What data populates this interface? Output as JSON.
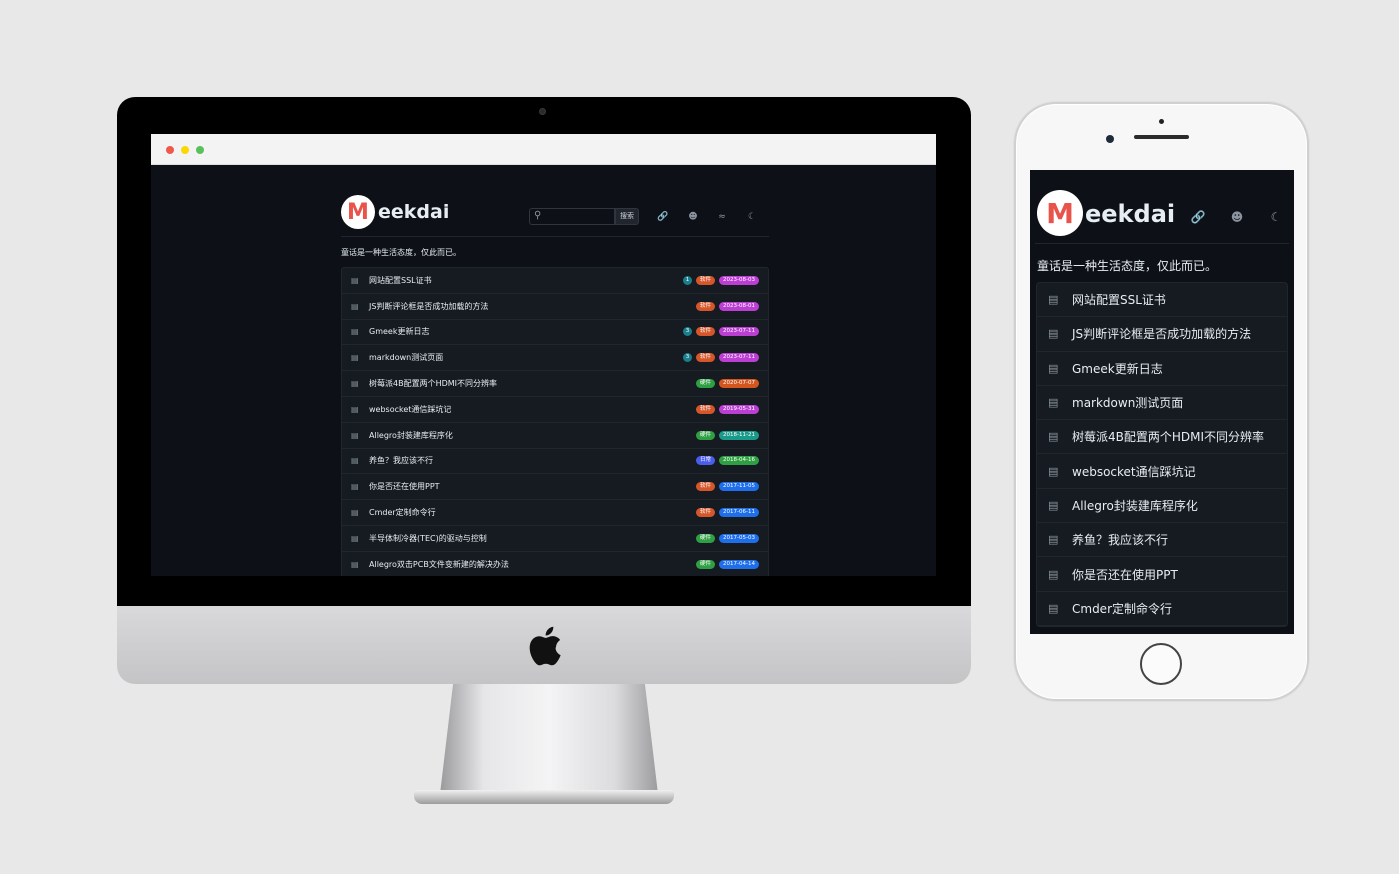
{
  "site": {
    "logo_letter": "M",
    "logo_text": "eekdai",
    "tagline": "童话是一种生活态度，仅此而已。",
    "search_placeholder": "",
    "search_button": "搜索",
    "header_icons": [
      "link-icon",
      "person-icon",
      "rss-icon",
      "moon-icon"
    ]
  },
  "colors": {
    "background": "#0d1117",
    "card": "#161b22",
    "text": "#e6edf3",
    "accent_logo": "#e8534a"
  },
  "posts": [
    {
      "title": "网站配置SSL证书",
      "count": "1",
      "label": "软件",
      "label_color": "#d4562a",
      "date": "2023-08-03",
      "date_color": "#bc3fd4"
    },
    {
      "title": "JS判断评论框是否成功加载的方法",
      "count": "",
      "label": "软件",
      "label_color": "#d4562a",
      "date": "2023-08-01",
      "date_color": "#bc3fd4"
    },
    {
      "title": "Gmeek更新日志",
      "count": "3",
      "label": "软件",
      "label_color": "#d4562a",
      "date": "2023-07-11",
      "date_color": "#bc3fd4"
    },
    {
      "title": "markdown测试页面",
      "count": "3",
      "label": "软件",
      "label_color": "#d4562a",
      "date": "2023-07-11",
      "date_color": "#bc3fd4"
    },
    {
      "title": "树莓派4B配置两个HDMI不同分辨率",
      "count": "",
      "label": "硬件",
      "label_color": "#2ea043",
      "date": "2020-07-07",
      "date_color": "#d4561f"
    },
    {
      "title": "websocket通信踩坑记",
      "count": "",
      "label": "软件",
      "label_color": "#d4562a",
      "date": "2019-05-31",
      "date_color": "#bc3fd4"
    },
    {
      "title": "Allegro封装建库程序化",
      "count": "",
      "label": "硬件",
      "label_color": "#2ea043",
      "date": "2018-11-21",
      "date_color": "#1a9a8a"
    },
    {
      "title": "养鱼？我应该不行",
      "count": "",
      "label": "日常",
      "label_color": "#4a5de8",
      "date": "2018-04-16",
      "date_color": "#2ea043"
    },
    {
      "title": "你是否还在使用PPT",
      "count": "",
      "label": "软件",
      "label_color": "#d4562a",
      "date": "2017-11-05",
      "date_color": "#1f6feb"
    },
    {
      "title": "Cmder定制命令行",
      "count": "",
      "label": "软件",
      "label_color": "#d4562a",
      "date": "2017-06-11",
      "date_color": "#1f6feb"
    },
    {
      "title": "半导体制冷器(TEC)的驱动与控制",
      "count": "",
      "label": "硬件",
      "label_color": "#2ea043",
      "date": "2017-05-03",
      "date_color": "#1f6feb"
    },
    {
      "title": "Allegro双击PCB文件变新建的解决办法",
      "count": "",
      "label": "硬件",
      "label_color": "#2ea043",
      "date": "2017-04-14",
      "date_color": "#1f6feb"
    }
  ]
}
